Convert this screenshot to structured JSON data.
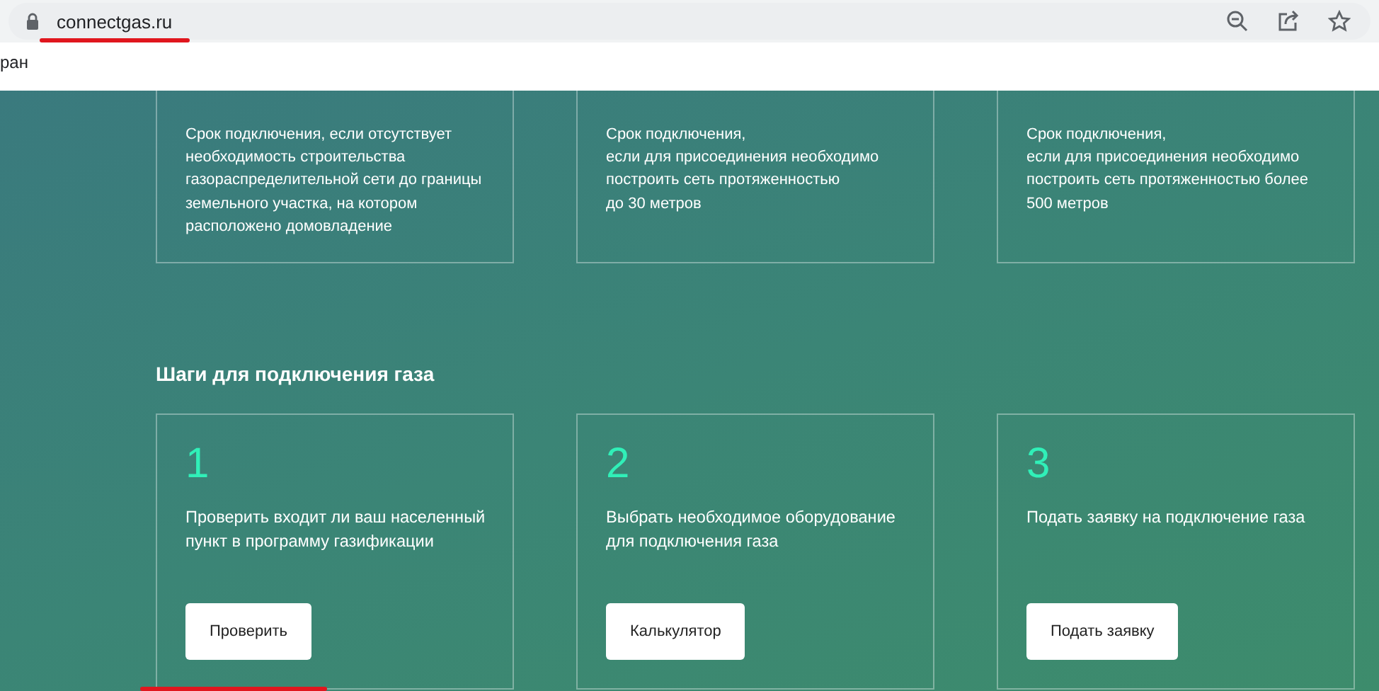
{
  "browser": {
    "url": "connectgas.ru",
    "url_underlined": true,
    "bookmark_text": "ран"
  },
  "term_cards": [
    {
      "text": "Срок подключения, если отсутствует необходимость строительства газораспределительной сети до границы земельного участка, на котором расположено домовладение"
    },
    {
      "text": "Срок подключения,\nесли для присоединения необходимо построить сеть протяженностью\nдо 30 метров"
    },
    {
      "text": "Срок подключения,\nесли для присоединения необходимо построить сеть протяженностью более 500 метров"
    }
  ],
  "steps_title": "Шаги для подключения газа",
  "steps": [
    {
      "number": "1",
      "text": "Проверить входит ли ваш населенный пункт в программу газификации",
      "button": "Проверить",
      "underlined": true
    },
    {
      "number": "2",
      "text": "Выбрать необходимое оборудование для подключения газа",
      "button": "Калькулятор",
      "underlined": false
    },
    {
      "number": "3",
      "text": "Подать заявку на подключение газа",
      "button": "Подать заявку",
      "underlined": false
    }
  ]
}
